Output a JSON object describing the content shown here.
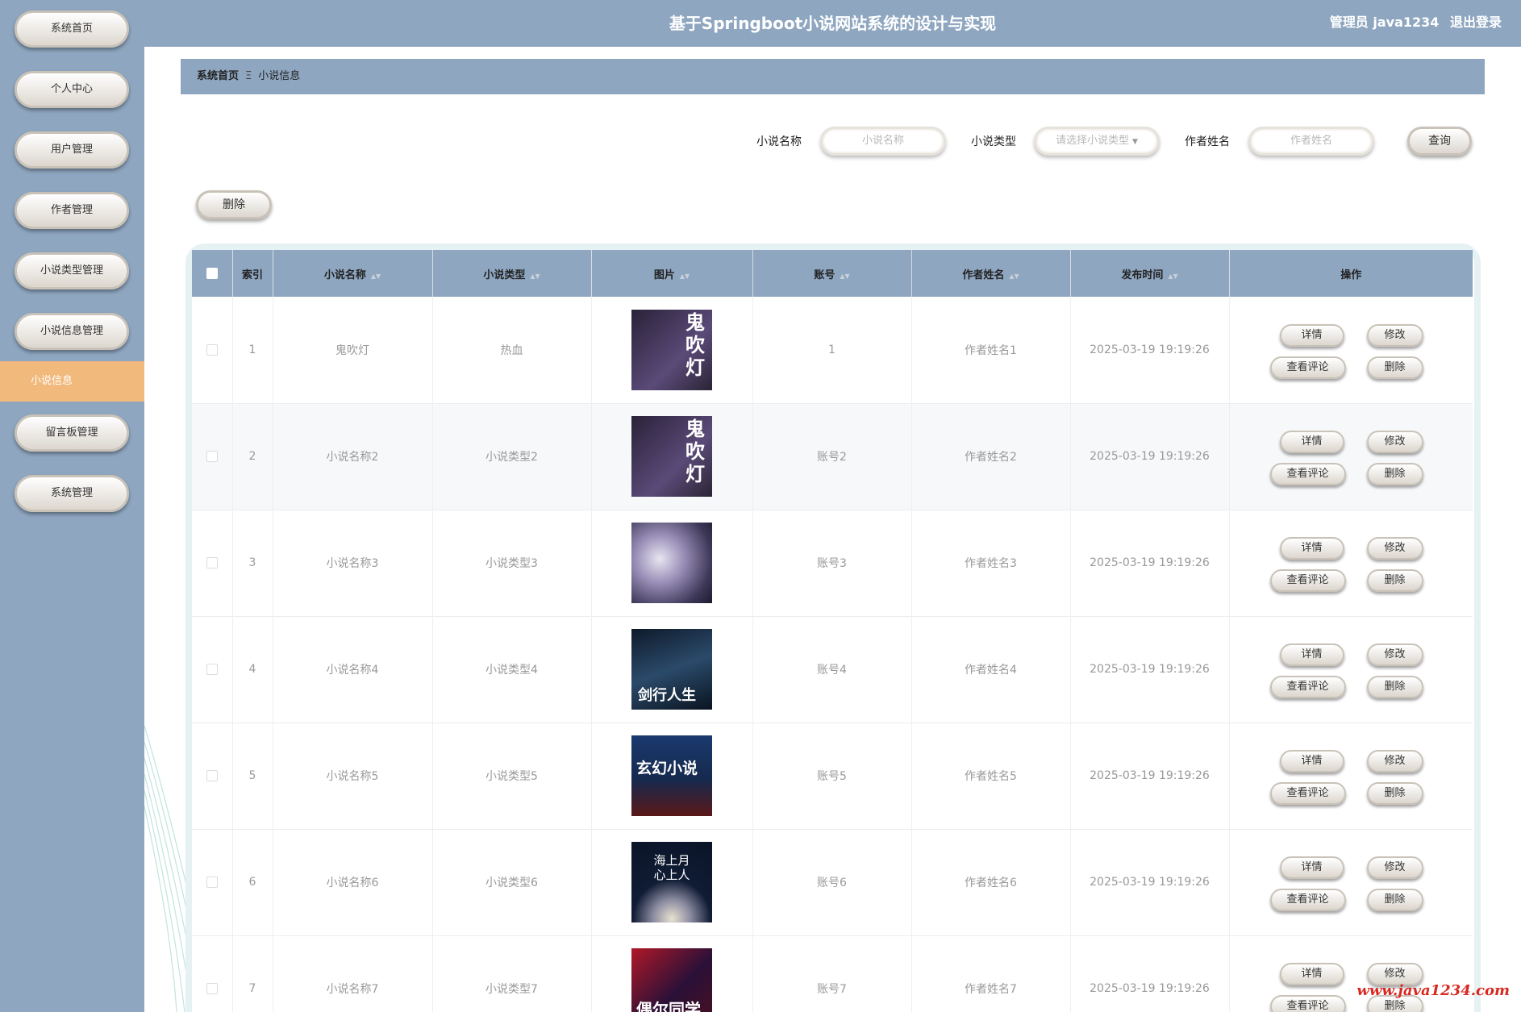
{
  "header": {
    "title": "基于Springboot小说网站系统的设计与实现",
    "user": "管理员 java1234",
    "logout": "退出登录"
  },
  "sidebar": {
    "items": [
      "系统首页",
      "个人中心",
      "用户管理",
      "作者管理",
      "小说类型管理",
      "小说信息管理"
    ],
    "active_sub": "小说信息",
    "items_after": [
      "留言板管理",
      "系统管理"
    ]
  },
  "breadcrumb": {
    "home": "系统首页",
    "sep": "Ξ",
    "current": "小说信息"
  },
  "search": {
    "name_label": "小说名称",
    "name_placeholder": "小说名称",
    "type_label": "小说类型",
    "type_placeholder": "请选择小说类型",
    "author_label": "作者姓名",
    "author_placeholder": "作者姓名",
    "query_button": "查询"
  },
  "toolbar": {
    "delete_button": "删除"
  },
  "table": {
    "headers": [
      "索引",
      "小说名称",
      "小说类型",
      "图片",
      "账号",
      "作者姓名",
      "发布时间",
      "操作"
    ],
    "rows": [
      {
        "index": "1",
        "name": "鬼吹灯",
        "type": "热血",
        "account": "1",
        "author": "作者姓名1",
        "time": "2025-03-19 19:19:26",
        "cover_text": "鬼吹灯"
      },
      {
        "index": "2",
        "name": "小说名称2",
        "type": "小说类型2",
        "account": "账号2",
        "author": "作者姓名2",
        "time": "2025-03-19 19:19:26",
        "cover_text": "鬼吹灯"
      },
      {
        "index": "3",
        "name": "小说名称3",
        "type": "小说类型3",
        "account": "账号3",
        "author": "作者姓名3",
        "time": "2025-03-19 19:19:26",
        "cover_text": ""
      },
      {
        "index": "4",
        "name": "小说名称4",
        "type": "小说类型4",
        "account": "账号4",
        "author": "作者姓名4",
        "time": "2025-03-19 19:19:26",
        "cover_text": "剑行人生"
      },
      {
        "index": "5",
        "name": "小说名称5",
        "type": "小说类型5",
        "account": "账号5",
        "author": "作者姓名5",
        "time": "2025-03-19 19:19:26",
        "cover_text": "玄幻小说"
      },
      {
        "index": "6",
        "name": "小说名称6",
        "type": "小说类型6",
        "account": "账号6",
        "author": "作者姓名6",
        "time": "2025-03-19 19:19:26",
        "cover_text": "海上月 心上人"
      },
      {
        "index": "7",
        "name": "小说名称7",
        "type": "小说类型7",
        "account": "账号7",
        "author": "作者姓名7",
        "time": "2025-03-19 19:19:26",
        "cover_text": "偶尔同学"
      }
    ],
    "ops": {
      "detail": "详情",
      "edit": "修改",
      "comments": "查看评论",
      "delete": "删除"
    }
  },
  "watermark": "www.java1234.com",
  "colors": {
    "primary": "#8ea6c0",
    "active": "#f2b97d",
    "watermark": "#d8281f"
  }
}
